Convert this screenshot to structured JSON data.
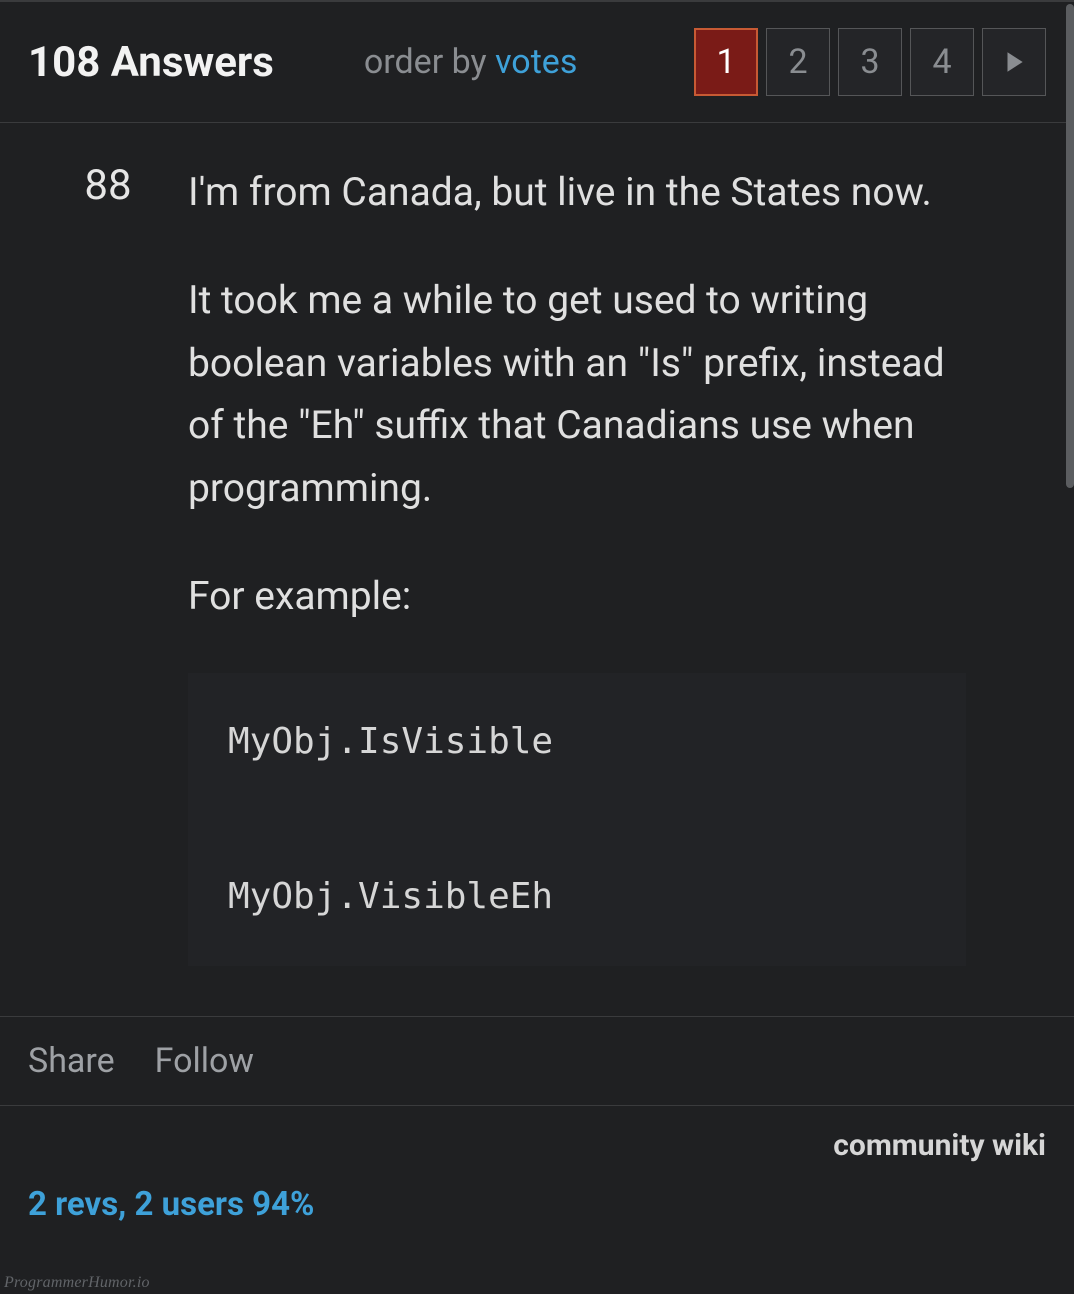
{
  "header": {
    "answers_label": "108 Answers",
    "order_by_label": "order by ",
    "votes_label": "votes"
  },
  "pagination": {
    "pages": [
      "1",
      "2",
      "3",
      "4"
    ],
    "active_index": 0
  },
  "answer": {
    "score": "88",
    "paragraphs": [
      "I'm from Canada, but live in the States now.",
      "It took me a while to get used to writing boolean variables with an \"Is\" prefix, instead of the \"Eh\" suffix that Canadians use when programming.",
      "For example:"
    ],
    "code": "MyObj.IsVisible\n\nMyObj.VisibleEh"
  },
  "actions": {
    "share": "Share",
    "follow": "Follow"
  },
  "footer": {
    "community_wiki": "community wiki",
    "revs": "2 revs, 2 users 94%"
  },
  "watermark": "ProgrammerHumor.io"
}
